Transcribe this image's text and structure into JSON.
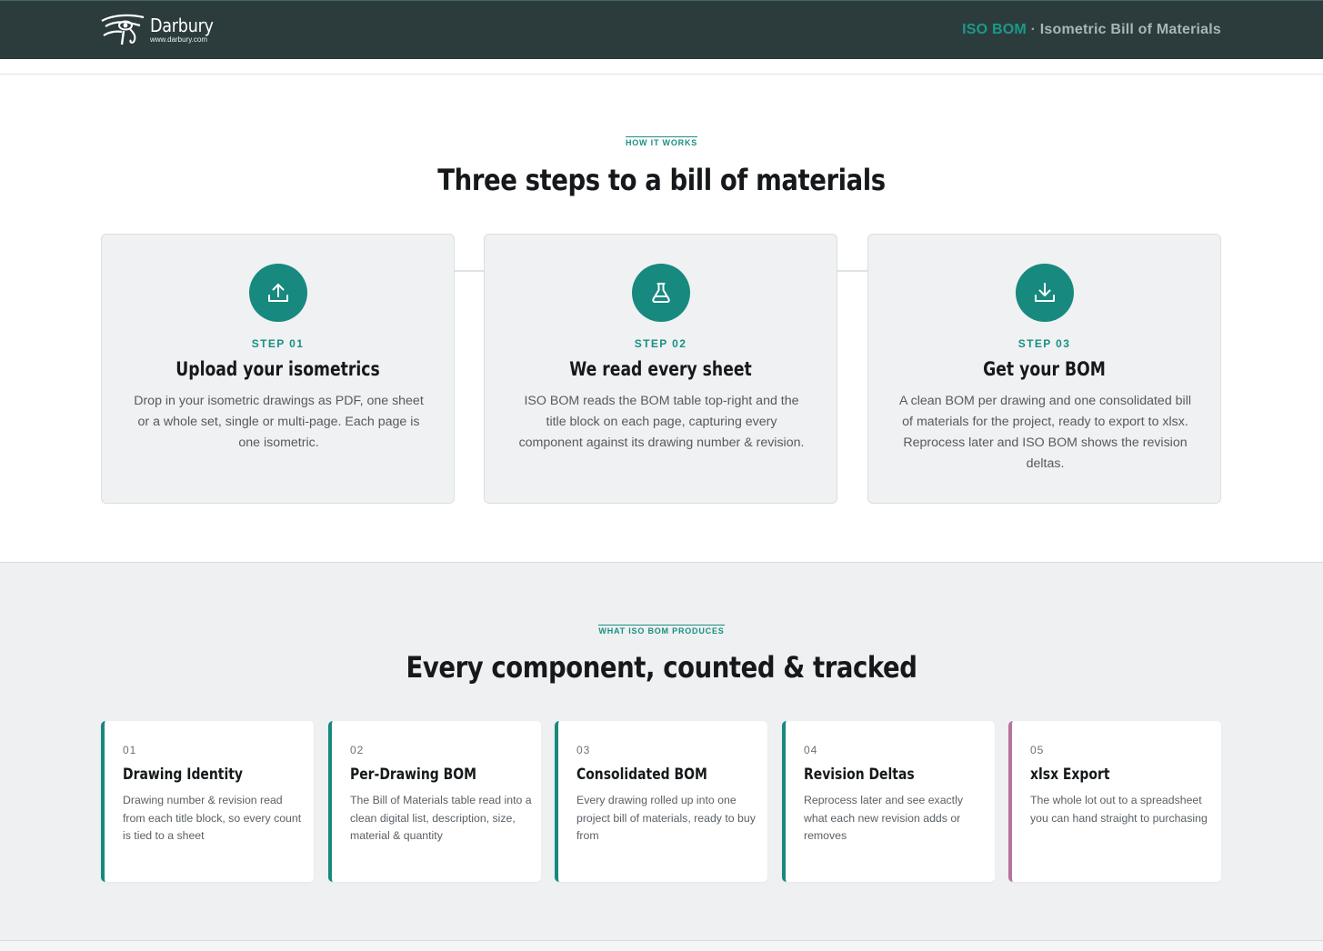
{
  "header": {
    "brand_name": "Darbury",
    "brand_url": "www.darbury.com",
    "product_accent": "ISO BOM",
    "separator": "·",
    "product_subtitle": "Isometric Bill of Materials",
    "colors": {
      "background": "#2c3c3d",
      "accent": "#1a9a8b"
    }
  },
  "how_it_works": {
    "eyebrow": "HOW IT WORKS",
    "title": "Three steps to a bill of materials",
    "steps": [
      {
        "icon": "upload-icon",
        "label": "STEP 01",
        "title": "Upload your isometrics",
        "body": "Drop in your isometric drawings as PDF, one sheet or a whole set, single or multi-page. Each page is one isometric."
      },
      {
        "icon": "flask-icon",
        "label": "STEP 02",
        "title": "We read every sheet",
        "body": "ISO BOM reads the BOM table top-right and the title block on each page, capturing every component against its drawing number & revision."
      },
      {
        "icon": "download-icon",
        "label": "STEP 03",
        "title": "Get your BOM",
        "body": "A clean BOM per drawing and one consolidated bill of materials for the project, ready to export to xlsx. Reprocess later and ISO BOM shows the revision deltas."
      }
    ]
  },
  "produces": {
    "eyebrow": "WHAT ISO BOM PRODUCES",
    "title": "Every component, counted & tracked",
    "features": [
      {
        "num": "01",
        "title": "Drawing Identity",
        "body": "Drawing number & revision read from each title block, so every count is tied to a sheet",
        "accent": "#17897f"
      },
      {
        "num": "02",
        "title": "Per-Drawing BOM",
        "body": "The Bill of Materials table read into a clean digital list, description, size, material & quantity",
        "accent": "#17897f"
      },
      {
        "num": "03",
        "title": "Consolidated BOM",
        "body": "Every drawing rolled up into one project bill of materials, ready to buy from",
        "accent": "#17897f"
      },
      {
        "num": "04",
        "title": "Revision Deltas",
        "body": "Reprocess later and see exactly what each new revision adds or removes",
        "accent": "#17897f"
      },
      {
        "num": "05",
        "title": "xlsx Export",
        "body": "The whole lot out to a spreadsheet you can hand straight to purchasing",
        "accent": "#b5739e"
      }
    ]
  }
}
